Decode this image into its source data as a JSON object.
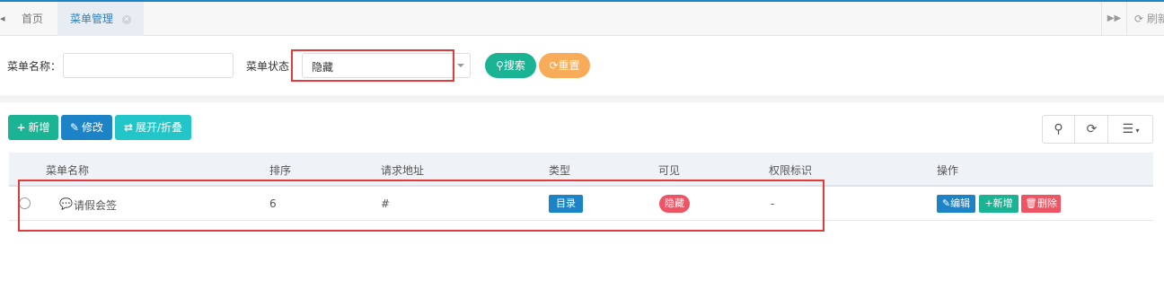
{
  "colors": {
    "primary": "#1c84c6",
    "success": "#1ab394",
    "info": "#23c6c8",
    "warning": "#f8ac59",
    "danger": "#ed5565",
    "highlight": "#e03c3c"
  },
  "tabs": {
    "home": "首页",
    "active": "菜单管理",
    "refresh": "刷新"
  },
  "search": {
    "name_label": "菜单名称：",
    "name_value": "",
    "status_label": "菜单状态：",
    "status_value": "隐藏",
    "search_label": "搜索",
    "reset_label": "重置"
  },
  "toolbar": {
    "add_label": "新增",
    "edit_label": "修改",
    "expand_label": "展开/折叠"
  },
  "table": {
    "columns": [
      "菜单名称",
      "排序",
      "请求地址",
      "类型",
      "可见",
      "权限标识",
      "操作"
    ],
    "rows": [
      {
        "name": "请假会签",
        "order": "6",
        "url": "#",
        "type": "目录",
        "visible": "隐藏",
        "perms": "-",
        "actions": {
          "edit": "编辑",
          "add": "新增",
          "delete": "删除"
        }
      }
    ]
  },
  "icons": {
    "tab_prev": "chevron-left-icon",
    "tab_close": "close-circle-icon",
    "tab_next": "double-chevron-right-icon",
    "refresh": "refresh-icon",
    "search": "search-icon",
    "reset": "refresh-icon",
    "add": "plus-icon",
    "edit": "edit-icon",
    "exchange": "exchange-icon",
    "columns": "list-icon",
    "comment": "comment-icon",
    "delete": "trash-icon"
  }
}
